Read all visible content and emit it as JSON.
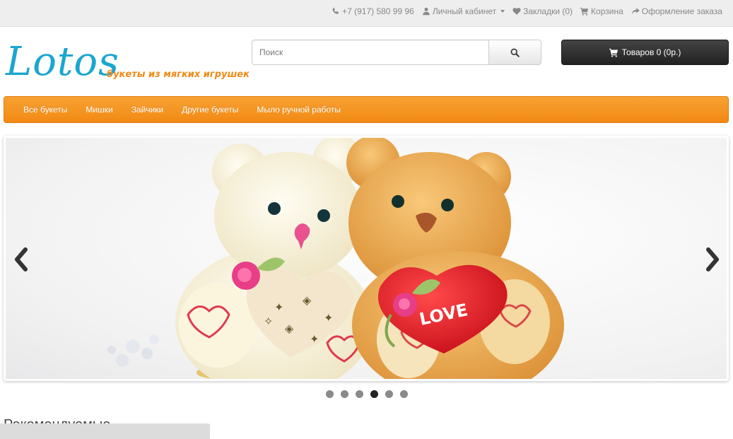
{
  "topbar": {
    "phone": "+7 (917) 580 99 96",
    "account": "Личный кабинет",
    "wishlist": "Закладки (0)",
    "cart": "Корзина",
    "checkout": "Оформление заказа"
  },
  "header": {
    "logo_text": "Lotos",
    "logo_tagline": "букеты из мягких игрушек",
    "search_placeholder": "Поиск",
    "cart_button": "Товаров 0 (0р.)"
  },
  "nav": {
    "items": [
      "Все букеты",
      "Мишки",
      "Зайчики",
      "Другие букеты",
      "Мыло ручной работы"
    ]
  },
  "slideshow": {
    "slide_count": 6,
    "active_index": 3,
    "image_subject": "teddy-bears-with-hearts",
    "heart_text": "LOVE"
  },
  "main": {
    "featured_heading": "Рекомендуемые"
  },
  "colors": {
    "brand_blue": "#1ba6cf",
    "brand_orange": "#f28913",
    "topbar_bg": "#eeeeee",
    "cart_button_bg": "#222222"
  },
  "icons": [
    "phone-icon",
    "user-icon",
    "heart-icon",
    "cart-icon",
    "share-icon",
    "search-icon",
    "chevron-left-icon",
    "chevron-right-icon"
  ]
}
